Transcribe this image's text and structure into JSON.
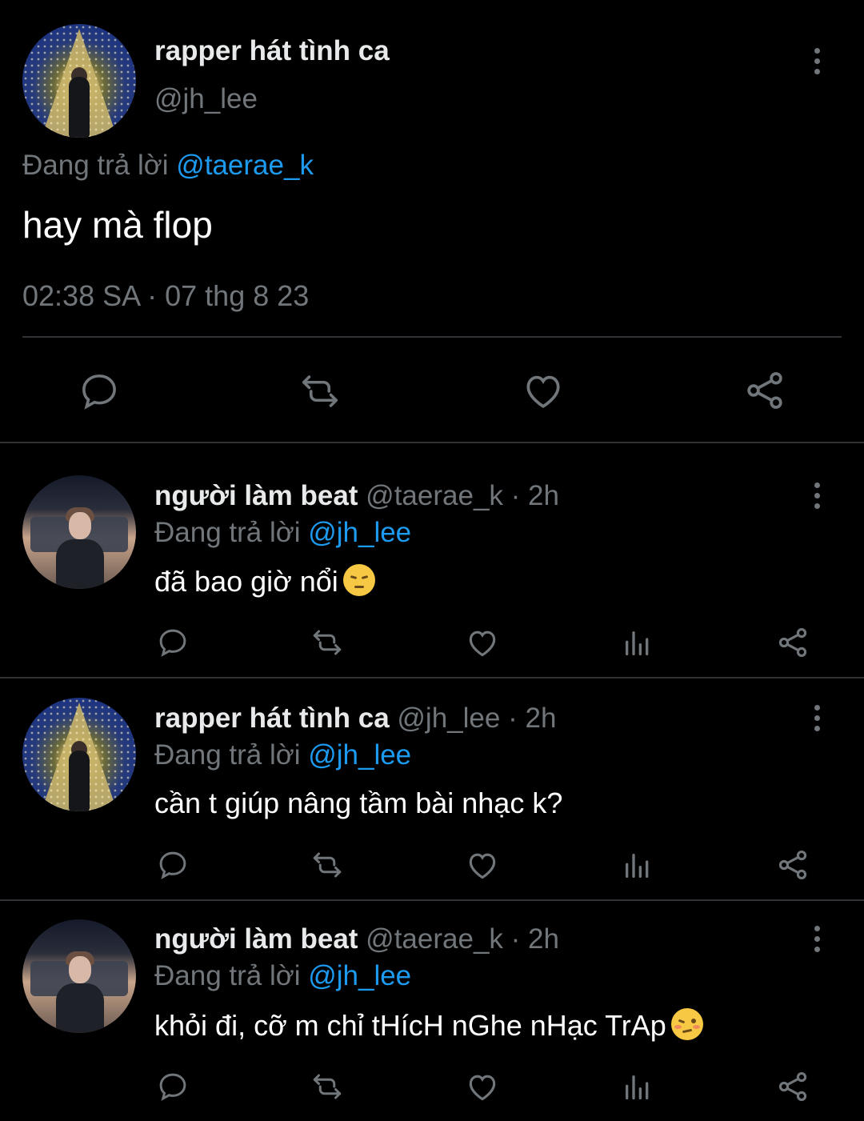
{
  "main_tweet": {
    "display_name": "rapper hát tình ca",
    "handle": "@jh_lee",
    "reply_prefix": "Đang trả lời",
    "reply_to": "@taerae_k",
    "text": "hay mà flop",
    "timestamp": "02:38 SA · 07 thg 8 23",
    "actions": [
      "reply-icon",
      "retweet-icon",
      "like-icon",
      "share-icon"
    ]
  },
  "replies": [
    {
      "display_name": "người làm beat",
      "handle": "@taerae_k",
      "time": "· 2h",
      "reply_prefix": "Đang trả lời",
      "reply_to": "@jh_lee",
      "text": "đã bao giờ nổi",
      "emoji": "pensive-face"
    },
    {
      "display_name": "rapper hát tình ca",
      "handle": "@jh_lee",
      "time": "· 2h",
      "reply_prefix": "Đang trả lời",
      "reply_to": "@jh_lee",
      "text": "cần t giúp nâng tầm bài nhạc k?",
      "emoji": ""
    },
    {
      "display_name": "người làm beat",
      "handle": "@taerae_k",
      "time": "· 2h",
      "reply_prefix": "Đang trả lời",
      "reply_to": "@jh_lee",
      "text": "khỏi đi, cỡ m chỉ tHícH nGhe nHạc TrAp",
      "emoji": "woozy-face"
    }
  ],
  "colors": {
    "background": "#000000",
    "text": "#e7e9ea",
    "muted": "#71767b",
    "link": "#1d9bf0",
    "divider": "#2f3336"
  }
}
